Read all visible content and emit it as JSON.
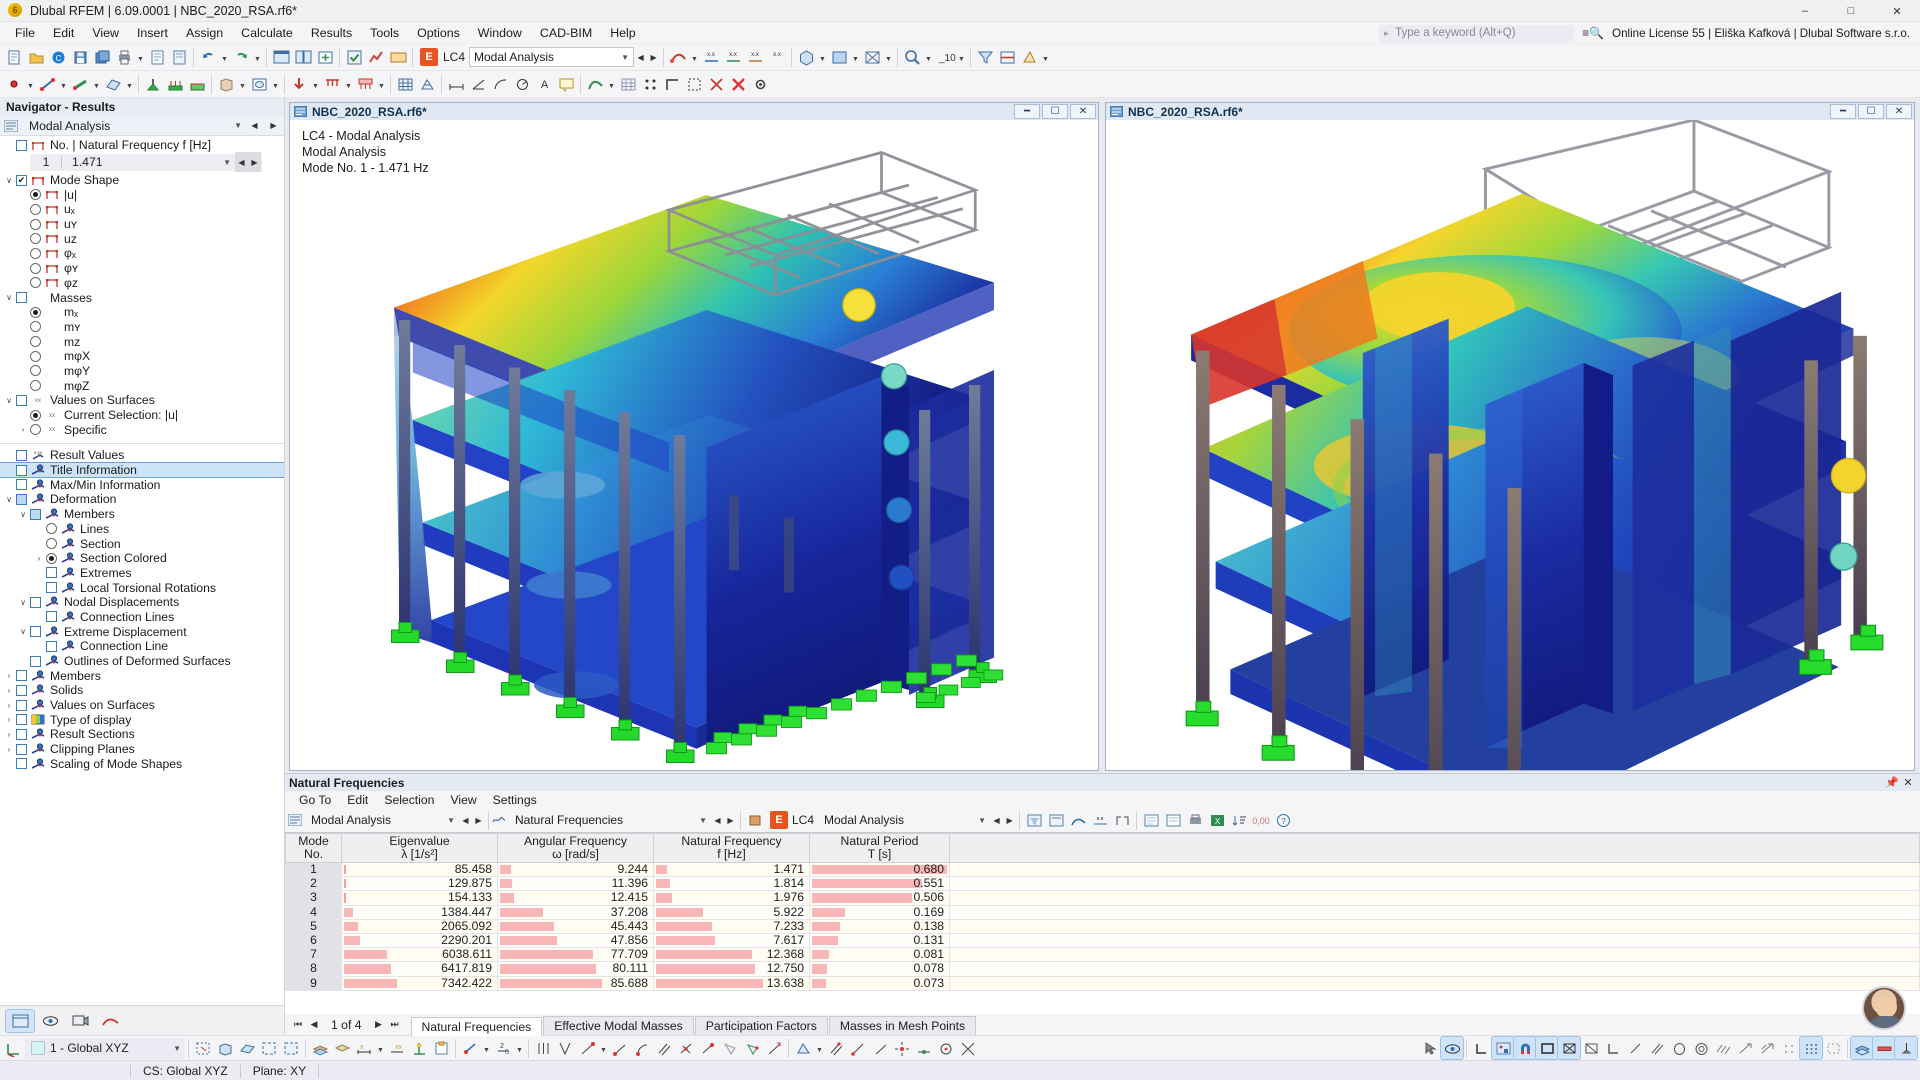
{
  "window": {
    "title": "Dlubal RFEM | 6.09.0001 | NBC_2020_RSA.rf6*",
    "minimize": "–",
    "maximize": "□",
    "close": "✕"
  },
  "menubar": {
    "items": [
      "File",
      "Edit",
      "View",
      "Insert",
      "Assign",
      "Calculate",
      "Results",
      "Tools",
      "Options",
      "Window",
      "CAD-BIM",
      "Help"
    ],
    "search_placeholder": "Type a keyword (Alt+Q)",
    "license": "Online License 55 | Eliška Kafková | Dlubal Software s.r.o."
  },
  "toolbar": {
    "load_case_badge": "E",
    "load_case": "LC4",
    "analysis_combo": "Modal Analysis",
    "scale_value": "10"
  },
  "navigator": {
    "header": "Navigator - Results",
    "combo_title": "Modal Analysis",
    "frequency_group": "No. | Natural Frequency f [Hz]",
    "frequency_no": "1",
    "frequency_value": "1.471",
    "tree": [
      {
        "label": "Mode Shape",
        "indent": 0,
        "ctl": "checkbox-on",
        "exp": "∨",
        "icon": "frame-icon"
      },
      {
        "label": "|u|",
        "indent": 1,
        "ctl": "radio-on",
        "icon": "frame-icon"
      },
      {
        "label": "uₓ",
        "indent": 1,
        "ctl": "radio",
        "icon": "frame-icon"
      },
      {
        "label": "uʏ",
        "indent": 1,
        "ctl": "radio",
        "icon": "frame-icon"
      },
      {
        "label": "uᴢ",
        "indent": 1,
        "ctl": "radio",
        "icon": "frame-icon"
      },
      {
        "label": "φₓ",
        "indent": 1,
        "ctl": "radio",
        "icon": "frame-icon"
      },
      {
        "label": "φʏ",
        "indent": 1,
        "ctl": "radio",
        "icon": "frame-icon"
      },
      {
        "label": "φᴢ",
        "indent": 1,
        "ctl": "radio",
        "icon": "frame-icon"
      },
      {
        "label": "Masses",
        "indent": 0,
        "ctl": "checkbox",
        "exp": "∨",
        "icon": "none"
      },
      {
        "label": "mₓ",
        "indent": 1,
        "ctl": "radio-on",
        "icon": "none"
      },
      {
        "label": "mʏ",
        "indent": 1,
        "ctl": "radio",
        "icon": "none"
      },
      {
        "label": "mᴢ",
        "indent": 1,
        "ctl": "radio",
        "icon": "none"
      },
      {
        "label": "mφX",
        "indent": 1,
        "ctl": "radio",
        "icon": "none"
      },
      {
        "label": "mφY",
        "indent": 1,
        "ctl": "radio",
        "icon": "none"
      },
      {
        "label": "mφZ",
        "indent": 1,
        "ctl": "radio",
        "icon": "none"
      },
      {
        "label": "Values on Surfaces",
        "indent": 0,
        "ctl": "checkbox",
        "exp": "∨",
        "icon": "xx-icon"
      },
      {
        "label": "Current Selection: |u|",
        "indent": 1,
        "ctl": "radio-on",
        "icon": "xx-icon"
      },
      {
        "label": "Specific",
        "indent": 1,
        "ctl": "radio",
        "exp": "›",
        "icon": "xx-icon"
      }
    ],
    "tree2": [
      {
        "label": "Result Values",
        "indent": 0,
        "ctl": "checkbox",
        "icon": "xxx-icon"
      },
      {
        "label": "Title Information",
        "indent": 0,
        "ctl": "checkbox",
        "icon": "res-icon",
        "selected": true
      },
      {
        "label": "Max/Min Information",
        "indent": 0,
        "ctl": "checkbox",
        "icon": "res-icon"
      },
      {
        "label": "Deformation",
        "indent": 0,
        "ctl": "checkbox-part",
        "exp": "∨",
        "icon": "res-icon"
      },
      {
        "label": "Members",
        "indent": 1,
        "ctl": "checkbox-part",
        "exp": "∨",
        "icon": "res-icon"
      },
      {
        "label": "Lines",
        "indent": 2,
        "ctl": "radio",
        "icon": "res-icon"
      },
      {
        "label": "Section",
        "indent": 2,
        "ctl": "radio",
        "icon": "res-icon"
      },
      {
        "label": "Section Colored",
        "indent": 2,
        "ctl": "radio-on",
        "exp": "›",
        "icon": "res-icon"
      },
      {
        "label": "Extremes",
        "indent": 2,
        "ctl": "checkbox",
        "icon": "res-icon"
      },
      {
        "label": "Local Torsional Rotations",
        "indent": 2,
        "ctl": "checkbox",
        "icon": "res-icon"
      },
      {
        "label": "Nodal Displacements",
        "indent": 1,
        "ctl": "checkbox",
        "exp": "∨",
        "icon": "res-icon"
      },
      {
        "label": "Connection Lines",
        "indent": 2,
        "ctl": "checkbox",
        "icon": "res-icon"
      },
      {
        "label": "Extreme Displacement",
        "indent": 1,
        "ctl": "checkbox",
        "exp": "∨",
        "icon": "res-icon"
      },
      {
        "label": "Connection Line",
        "indent": 2,
        "ctl": "checkbox",
        "icon": "res-icon"
      },
      {
        "label": "Outlines of Deformed Surfaces",
        "indent": 1,
        "ctl": "checkbox",
        "icon": "res-icon"
      },
      {
        "label": "Members",
        "indent": 0,
        "ctl": "checkbox",
        "exp": "›",
        "icon": "res-icon"
      },
      {
        "label": "Solids",
        "indent": 0,
        "ctl": "checkbox",
        "exp": "›",
        "icon": "res-icon"
      },
      {
        "label": "Values on Surfaces",
        "indent": 0,
        "ctl": "checkbox",
        "exp": "›",
        "icon": "res-icon"
      },
      {
        "label": "Type of display",
        "indent": 0,
        "ctl": "checkbox",
        "exp": "›",
        "icon": "color-icon"
      },
      {
        "label": "Result Sections",
        "indent": 0,
        "ctl": "checkbox",
        "exp": "›",
        "icon": "res-icon"
      },
      {
        "label": "Clipping Planes",
        "indent": 0,
        "ctl": "checkbox",
        "exp": "›",
        "icon": "res-icon"
      },
      {
        "label": "Scaling of Mode Shapes",
        "indent": 0,
        "ctl": "checkbox",
        "icon": "res-icon"
      }
    ]
  },
  "views": {
    "left": {
      "title": "NBC_2020_RSA.rf6*",
      "info_line1": "LC4 - Modal Analysis",
      "info_line2": "Modal Analysis",
      "info_line3": "Mode No. 1 - 1.471 Hz"
    },
    "right": {
      "title": "NBC_2020_RSA.rf6*"
    }
  },
  "table_panel": {
    "header": "Natural Frequencies",
    "menu": [
      "Go To",
      "Edit",
      "Selection",
      "View",
      "Settings"
    ],
    "combo_left": "Modal Analysis",
    "combo_mid": "Natural Frequencies",
    "lc_badge": "E",
    "lc_label": "LC4",
    "combo_right": "Modal Analysis",
    "pager": "1 of 4",
    "tabs": [
      "Natural Frequencies",
      "Effective Modal Masses",
      "Participation Factors",
      "Masses in Mesh Points"
    ],
    "active_tab": "Natural Frequencies"
  },
  "chart_data": {
    "type": "table",
    "title": "Natural Frequencies",
    "columns": [
      {
        "header": "Mode",
        "sub": "No."
      },
      {
        "header": "Eigenvalue",
        "sub": "λ [1/s²]"
      },
      {
        "header": "Angular Frequency",
        "sub": "ω [rad/s]"
      },
      {
        "header": "Natural Frequency",
        "sub": "f [Hz]"
      },
      {
        "header": "Natural Period",
        "sub": "T [s]"
      }
    ],
    "rows": [
      {
        "mode": "1",
        "eigenvalue": "85.458",
        "omega": "9.244",
        "freq": "1.471",
        "period": "0.680",
        "bars": {
          "eigenvalue": 0.5,
          "omega": 7,
          "freq": 7,
          "period": 97
        }
      },
      {
        "mode": "2",
        "eigenvalue": "129.875",
        "omega": "11.396",
        "freq": "1.814",
        "period": "0.551",
        "bars": {
          "eigenvalue": 0.6,
          "omega": 8,
          "freq": 9,
          "period": 79
        }
      },
      {
        "mode": "3",
        "eigenvalue": "154.133",
        "omega": "12.415",
        "freq": "1.976",
        "period": "0.506",
        "bars": {
          "eigenvalue": 0.7,
          "omega": 9,
          "freq": 10,
          "period": 72
        }
      },
      {
        "mode": "4",
        "eigenvalue": "1384.447",
        "omega": "37.208",
        "freq": "5.922",
        "period": "0.169",
        "bars": {
          "eigenvalue": 6,
          "omega": 28,
          "freq": 30,
          "period": 24
        }
      },
      {
        "mode": "5",
        "eigenvalue": "2065.092",
        "omega": "45.443",
        "freq": "7.233",
        "period": "0.138",
        "bars": {
          "eigenvalue": 9,
          "omega": 35,
          "freq": 36,
          "period": 20
        }
      },
      {
        "mode": "6",
        "eigenvalue": "2290.201",
        "omega": "47.856",
        "freq": "7.617",
        "period": "0.131",
        "bars": {
          "eigenvalue": 10,
          "omega": 37,
          "freq": 38,
          "period": 19
        }
      },
      {
        "mode": "7",
        "eigenvalue": "6038.611",
        "omega": "77.709",
        "freq": "12.368",
        "period": "0.081",
        "bars": {
          "eigenvalue": 28,
          "omega": 60,
          "freq": 62,
          "period": 12
        }
      },
      {
        "mode": "8",
        "eigenvalue": "6417.819",
        "omega": "80.111",
        "freq": "12.750",
        "period": "0.078",
        "bars": {
          "eigenvalue": 30,
          "omega": 62,
          "freq": 64,
          "period": 11
        }
      },
      {
        "mode": "9",
        "eigenvalue": "7342.422",
        "omega": "85.688",
        "freq": "13.638",
        "period": "0.073",
        "bars": {
          "eigenvalue": 34,
          "omega": 66,
          "freq": 69,
          "period": 10
        }
      }
    ],
    "xlabel": "",
    "ylabel": "",
    "grid": true
  },
  "statusbar": {
    "cs_combo": "1 - Global XYZ",
    "cs_text": "CS: Global XYZ",
    "plane_text": "Plane: XY"
  }
}
